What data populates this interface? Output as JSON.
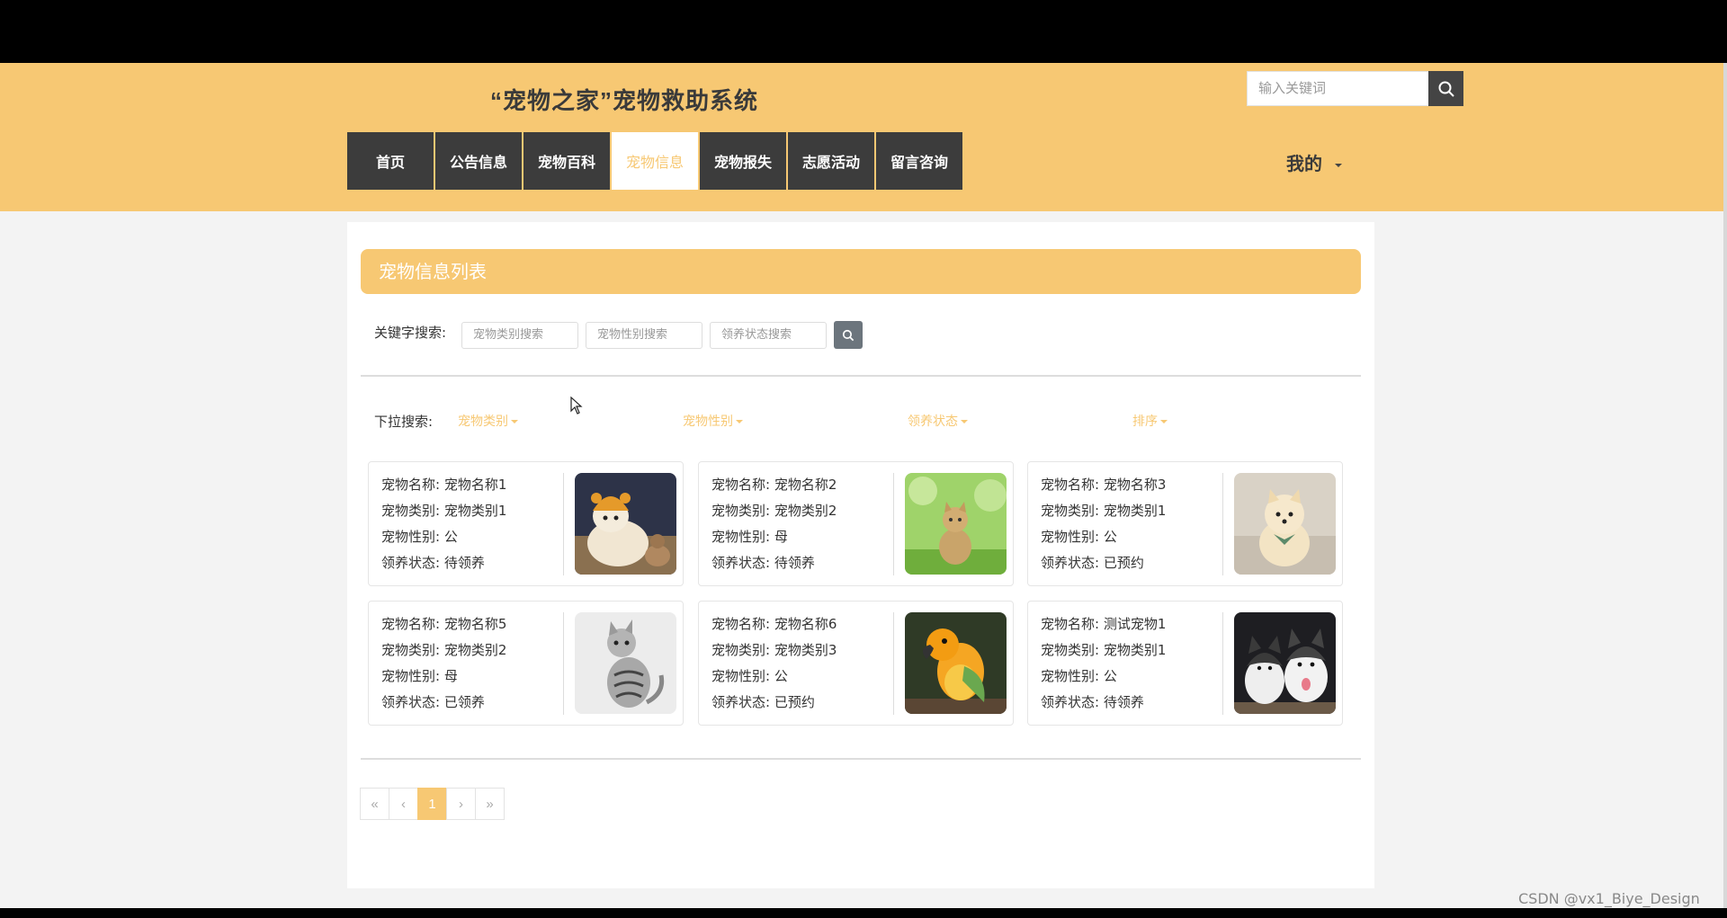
{
  "site": {
    "title": "“宠物之家”宠物救助系统"
  },
  "search": {
    "placeholder": "输入关键词",
    "icon": "search-icon"
  },
  "nav": {
    "items": [
      {
        "label": "首页"
      },
      {
        "label": "公告信息"
      },
      {
        "label": "宠物百科"
      },
      {
        "label": "宠物信息",
        "active": true
      },
      {
        "label": "宠物报失"
      },
      {
        "label": "志愿活动"
      },
      {
        "label": "留言咨询"
      }
    ],
    "mine_label": "我的"
  },
  "list": {
    "title": "宠物信息列表"
  },
  "keyword_search": {
    "label": "关键字搜索:",
    "category_placeholder": "宠物类别搜索",
    "gender_placeholder": "宠物性别搜索",
    "status_placeholder": "领养状态搜索"
  },
  "dropdown_search": {
    "label": "下拉搜索:",
    "category": "宠物类别",
    "gender": "宠物性别",
    "status": "领养状态",
    "sort": "排序"
  },
  "pets": [
    {
      "name": "宠物名称: 宠物名称1",
      "category": "宠物类别: 宠物类别1",
      "gender": "宠物性别: 公",
      "status": "领养状态: 待领养",
      "image": "dog-in-hat"
    },
    {
      "name": "宠物名称: 宠物名称2",
      "category": "宠物类别: 宠物类别2",
      "gender": "宠物性别: 母",
      "status": "领养状态: 待领养",
      "image": "kitten-in-grass"
    },
    {
      "name": "宠物名称: 宠物名称3",
      "category": "宠物类别: 宠物类别1",
      "gender": "宠物性别: 公",
      "status": "领养状态: 已预约",
      "image": "pomeranian"
    },
    {
      "name": "宠物名称: 宠物名称5",
      "category": "宠物类别: 宠物类别2",
      "gender": "宠物性别: 母",
      "status": "领养状态: 已领养",
      "image": "tabby-cat"
    },
    {
      "name": "宠物名称: 宠物名称6",
      "category": "宠物类别: 宠物类别3",
      "gender": "宠物性别: 公",
      "status": "领养状态: 已预约",
      "image": "parrot"
    },
    {
      "name": "宠物名称: 测试宠物1",
      "category": "宠物类别: 宠物类别1",
      "gender": "宠物性别: 公",
      "status": "领养状态: 待领养",
      "image": "husky-puppies"
    }
  ],
  "pagination": {
    "first": "«",
    "prev": "‹",
    "current": "1",
    "next": "›",
    "last": "»"
  },
  "watermark": "CSDN @vx1_Biye_Design",
  "colors": {
    "accent": "#f7c873",
    "nav_bg": "#3c3c3c"
  }
}
